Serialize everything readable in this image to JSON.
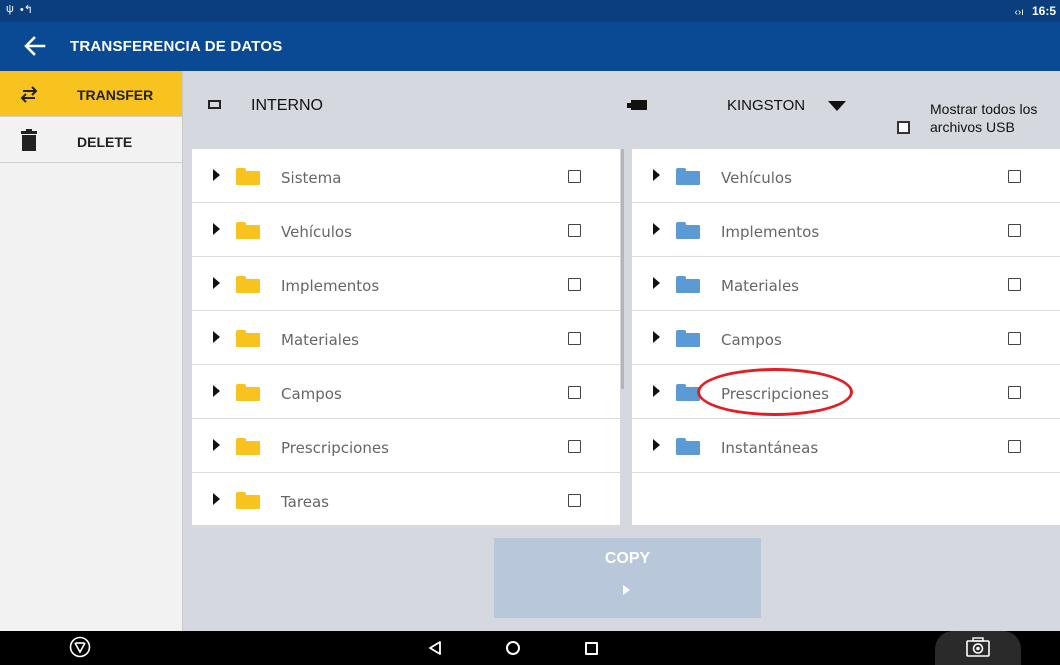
{
  "app": {
    "title": "TRANSFERENCIA DE DATOS"
  },
  "status": {
    "time": "16:5",
    "signal": "‹›ı"
  },
  "sidebar": {
    "items": [
      {
        "label": "TRANSFER",
        "icon": "swap-arrows-icon",
        "active": true
      },
      {
        "label": "DELETE",
        "icon": "trash-icon",
        "active": false
      }
    ]
  },
  "left_panel": {
    "source_label": "INTERNO",
    "folder_color": "#f8c21f",
    "folders": [
      "Sistema",
      "Vehículos",
      "Implementos",
      "Materiales",
      "Campos",
      "Prescripciones",
      "Tareas"
    ]
  },
  "right_panel": {
    "device_label": "KINGSTON",
    "show_all_label": "Mostrar todos los archivos USB",
    "folder_color": "#5b9ad4",
    "folders": [
      "Vehículos",
      "Implementos",
      "Materiales",
      "Campos",
      "Prescripciones",
      "Instantáneas"
    ]
  },
  "actions": {
    "copy_label": "COPY"
  },
  "colors": {
    "appbar": "#0a4a94",
    "accent": "#f8c21f",
    "highlight": "#e41d24"
  }
}
